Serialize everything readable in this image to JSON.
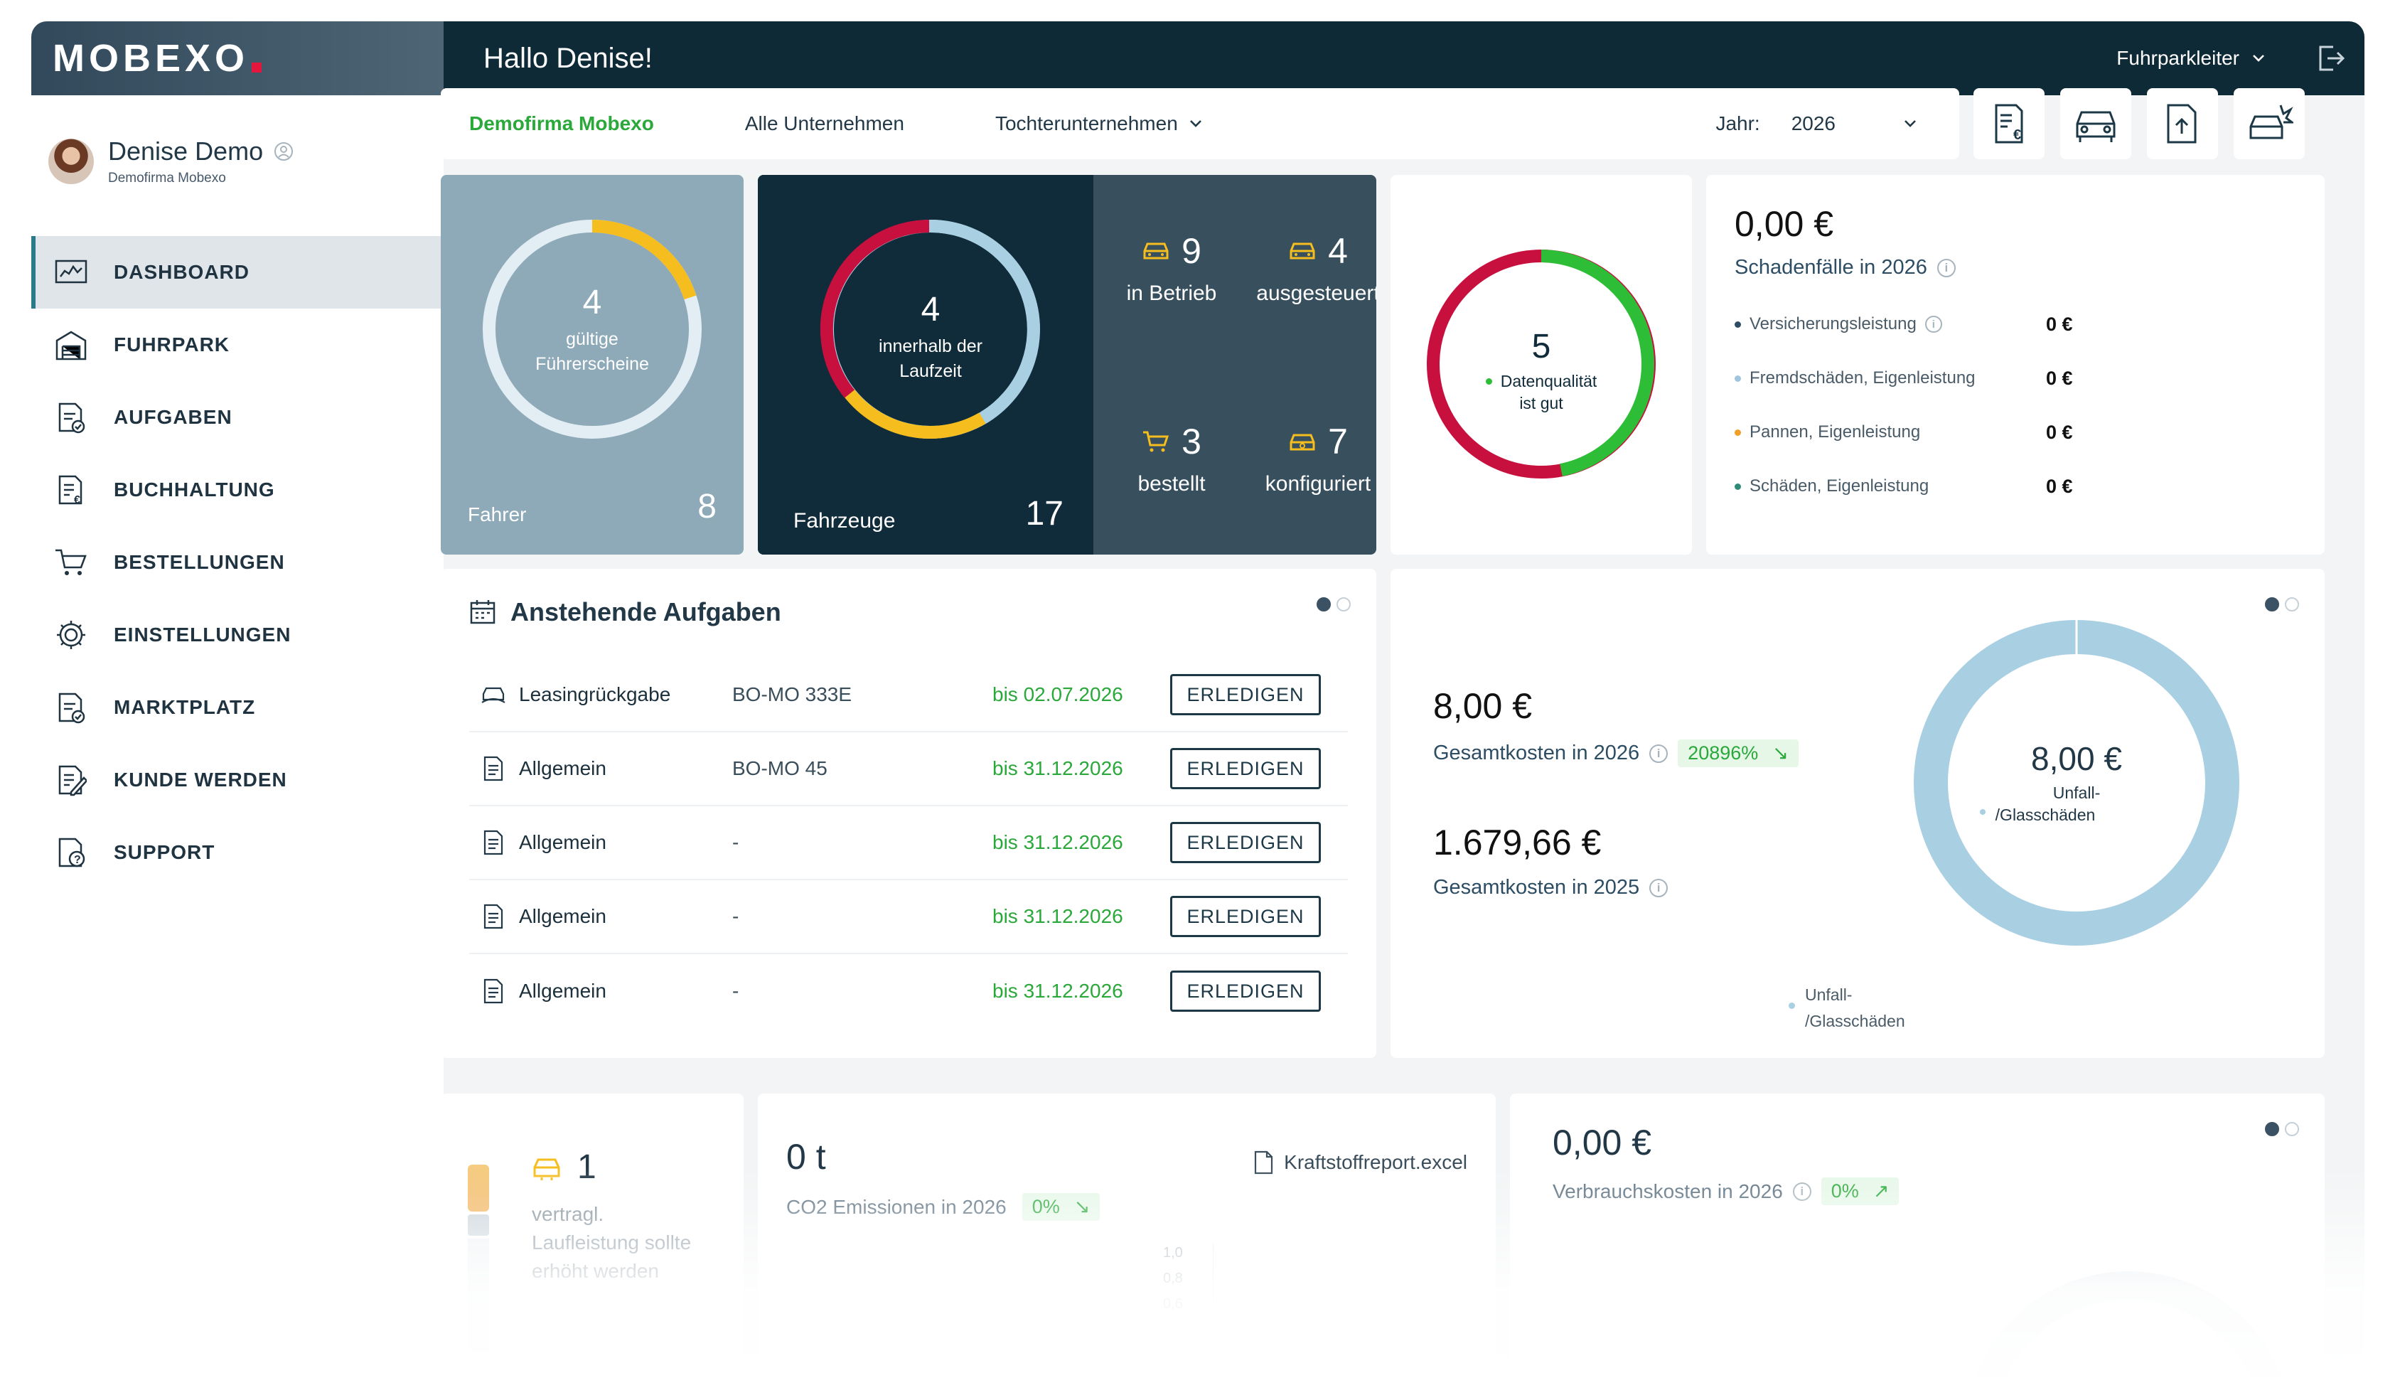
{
  "app": {
    "logo": "MOBEXO",
    "greeting": "Hallo Denise!",
    "role": "Fuhrparkleiter"
  },
  "profile": {
    "name": "Denise Demo",
    "company": "Demofirma Mobexo"
  },
  "nav": [
    {
      "label": "DASHBOARD",
      "icon": "dashboard-icon",
      "active": true
    },
    {
      "label": "FUHRPARK",
      "icon": "garage-icon"
    },
    {
      "label": "AUFGABEN",
      "icon": "tasks-icon"
    },
    {
      "label": "BUCHHALTUNG",
      "icon": "invoice-icon"
    },
    {
      "label": "BESTELLUNGEN",
      "icon": "cart-icon"
    },
    {
      "label": "EINSTELLUNGEN",
      "icon": "settings-icon"
    },
    {
      "label": "MARKTPLATZ",
      "icon": "marketplace-icon"
    },
    {
      "label": "KUNDE WERDEN",
      "icon": "form-icon"
    },
    {
      "label": "SUPPORT",
      "icon": "support-icon"
    }
  ],
  "filter": {
    "company": "Demofirma Mobexo",
    "all": "Alle Unternehmen",
    "subsidiaries": "Tochterunternehmen",
    "year_label": "Jahr:",
    "year": "2026"
  },
  "drivers": {
    "ring_value": "4",
    "ring_label_1": "gültige",
    "ring_label_2": "Führerscheine",
    "title": "Fahrer",
    "count": "8",
    "valid_fraction": 0.5
  },
  "vehicles": {
    "ring_value": "4",
    "ring_label_1": "innerhalb der",
    "ring_label_2": "Laufzeit",
    "title": "Fahrzeuge",
    "count": "17",
    "stats": [
      {
        "value": "9",
        "label": "in Betrieb"
      },
      {
        "value": "4",
        "label": "ausgesteuert"
      },
      {
        "value": "3",
        "label": "bestellt"
      },
      {
        "value": "7",
        "label": "konfiguriert"
      }
    ]
  },
  "data_quality": {
    "value": "5",
    "label_1": "Datenqualität",
    "label_2": "ist gut"
  },
  "damage": {
    "amount": "0,00 €",
    "label": "Schadenfälle in 2026",
    "rows": [
      {
        "label": "Versicherungsleistung",
        "value": "0 €",
        "color": "#2c4d63"
      },
      {
        "label": "Fremdschäden, Eigenleistung",
        "value": "0 €",
        "color": "#9fc6de"
      },
      {
        "label": "Pannen, Eigenleistung",
        "value": "0 €",
        "color": "#f0a028"
      },
      {
        "label": "Schäden, Eigenleistung",
        "value": "0 €",
        "color": "#2e8b7a"
      }
    ]
  },
  "tasks": {
    "title": "Anstehende Aufgaben",
    "button_label": "ERLEDIGEN",
    "rows": [
      {
        "name": "Leasingrückgabe",
        "plate": "BO-MO 333E",
        "due": "bis 02.07.2026",
        "icon": "lease-return-icon"
      },
      {
        "name": "Allgemein",
        "plate": "BO-MO 45",
        "due": "bis 31.12.2026",
        "icon": "document-icon"
      },
      {
        "name": "Allgemein",
        "plate": "-",
        "due": "bis 31.12.2026",
        "icon": "document-icon"
      },
      {
        "name": "Allgemein",
        "plate": "-",
        "due": "bis 31.12.2026",
        "icon": "document-icon"
      },
      {
        "name": "Allgemein",
        "plate": "-",
        "due": "bis 31.12.2026",
        "icon": "document-icon"
      }
    ]
  },
  "costs": {
    "current_amount": "8,00 €",
    "current_label": "Gesamtkosten in 2026",
    "current_change": "20896%",
    "previous_amount": "1.679,66 €",
    "previous_label": "Gesamtkosten in 2025",
    "donut_value": "8,00 €",
    "donut_label_1": "Unfall-",
    "donut_label_2": "/Glasschäden",
    "legend_1": "Unfall-",
    "legend_2": "/Glasschäden"
  },
  "mileage": {
    "value": "1",
    "line_1": "vertragl.",
    "line_2": "Laufleistung sollte",
    "line_3": "erhöht werden"
  },
  "co2": {
    "amount": "0 t",
    "label": "CO2 Emissionen in 2026",
    "change": "0%",
    "report": "Kraftstoffreport.excel",
    "ticks": [
      "1,0",
      "0,8",
      "0,6"
    ]
  },
  "consumption": {
    "amount": "0,00 €",
    "label": "Verbrauchskosten in 2026",
    "change": "0%"
  },
  "colors": {
    "accent_green": "#2aa83a",
    "navy": "#0f2a37",
    "brand_red": "#e3173e",
    "gold": "#f5be1e",
    "crimson": "#c8103f",
    "light_blue": "#a9cfe3"
  }
}
